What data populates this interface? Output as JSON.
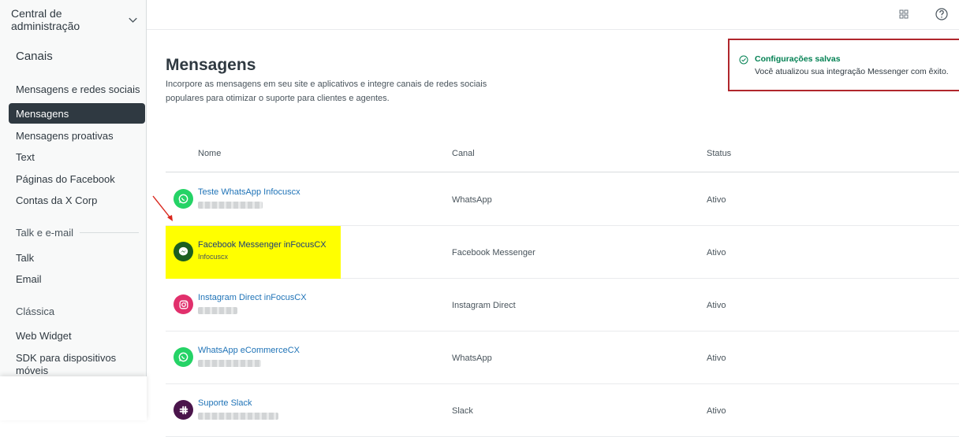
{
  "sidebar": {
    "header": "Central de administração",
    "section_title": "Canais",
    "items": [
      {
        "label": "Mensagens e redes sociais"
      },
      {
        "label": "Mensagens",
        "active": true
      },
      {
        "label": "Mensagens proativas"
      },
      {
        "label": "Text"
      },
      {
        "label": "Páginas do Facebook"
      },
      {
        "label": "Contas da X Corp"
      }
    ],
    "group_talk": "Talk e e-mail",
    "talk_items": [
      {
        "label": "Talk"
      },
      {
        "label": "Email"
      }
    ],
    "group_classic": "Clássica",
    "classic_items": [
      {
        "label": "Web Widget"
      },
      {
        "label": "SDK para dispositivos móveis"
      }
    ]
  },
  "topbar": {
    "icons": [
      "apps-grid-icon",
      "help-icon"
    ]
  },
  "main": {
    "title": "Mensagens",
    "description": "Incorpore as mensagens em seu site e aplicativos e integre canais de redes sociais populares para otimizar o suporte para clientes e agentes."
  },
  "table": {
    "headers": {
      "name": "Nome",
      "channel": "Canal",
      "status": "Status"
    },
    "rows": [
      {
        "name": "Teste WhatsApp Infocuscx",
        "subtitle": "",
        "channel": "WhatsApp",
        "status": "Ativo",
        "icon": "whatsapp-icon",
        "color": "#25d366"
      },
      {
        "name": "Facebook Messenger inFocusCX",
        "subtitle": "Infocuscx",
        "channel": "Facebook Messenger",
        "status": "Ativo",
        "icon": "messenger-icon",
        "color": "#1b5e20",
        "highlighted": true
      },
      {
        "name": "Instagram Direct inFocusCX",
        "subtitle": "",
        "channel": "Instagram Direct",
        "status": "Ativo",
        "icon": "instagram-icon",
        "color": "#e1306c"
      },
      {
        "name": "WhatsApp eCommerceCX",
        "subtitle": "",
        "channel": "WhatsApp",
        "status": "Ativo",
        "icon": "whatsapp-icon",
        "color": "#25d366"
      },
      {
        "name": "Suporte Slack",
        "subtitle": "",
        "channel": "Slack",
        "status": "Ativo",
        "icon": "slack-icon",
        "color": "#4a154b"
      }
    ]
  },
  "toast": {
    "title": "Configurações salvas",
    "message": "Você atualizou sua integração Messenger com êxito.",
    "accent": "#038153",
    "border": "#b0262c"
  }
}
